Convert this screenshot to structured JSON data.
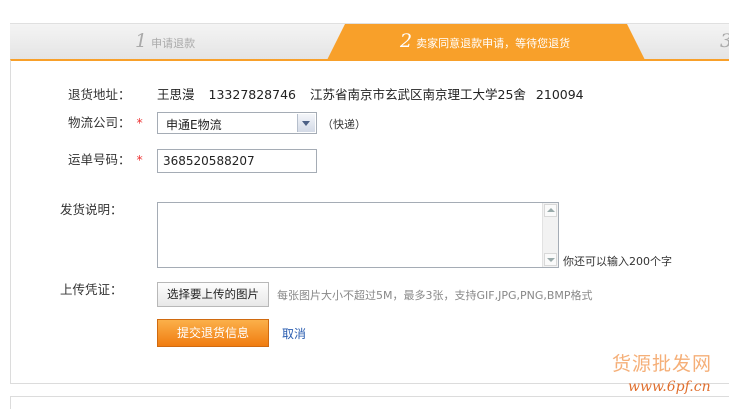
{
  "steps": [
    {
      "num": "1",
      "label": "申请退款"
    },
    {
      "num": "2",
      "label": "卖家同意退款申请，等待您退货"
    },
    {
      "num": "3"
    }
  ],
  "form": {
    "address": {
      "label": "退货地址：",
      "name": "王思漫",
      "phone": "13327828746",
      "addr": "江苏省南京市玄武区南京理工大学25舍",
      "zip": "210094"
    },
    "logistics": {
      "label": "物流公司：",
      "required": "*",
      "selected": "申通E物流",
      "note": "（快递）"
    },
    "tracking": {
      "label": "运单号码：",
      "required": "*",
      "value": "368520588207"
    },
    "description": {
      "label": "发货说明：",
      "value": "",
      "hint": "你还可以输入200个字"
    },
    "upload": {
      "label": "上传凭证：",
      "button": "选择要上传的图片",
      "hint": "每张图片大小不超过5M，最多3张，支持GIF,JPG,PNG,BMP格式"
    },
    "submit": "提交退货信息",
    "cancel": "取消"
  },
  "watermark": {
    "line1": "货源批发网",
    "line2": "www.6pf.cn"
  },
  "colors": {
    "accent": "#f8a02a",
    "link": "#2a5db0",
    "required": "#e33333"
  }
}
